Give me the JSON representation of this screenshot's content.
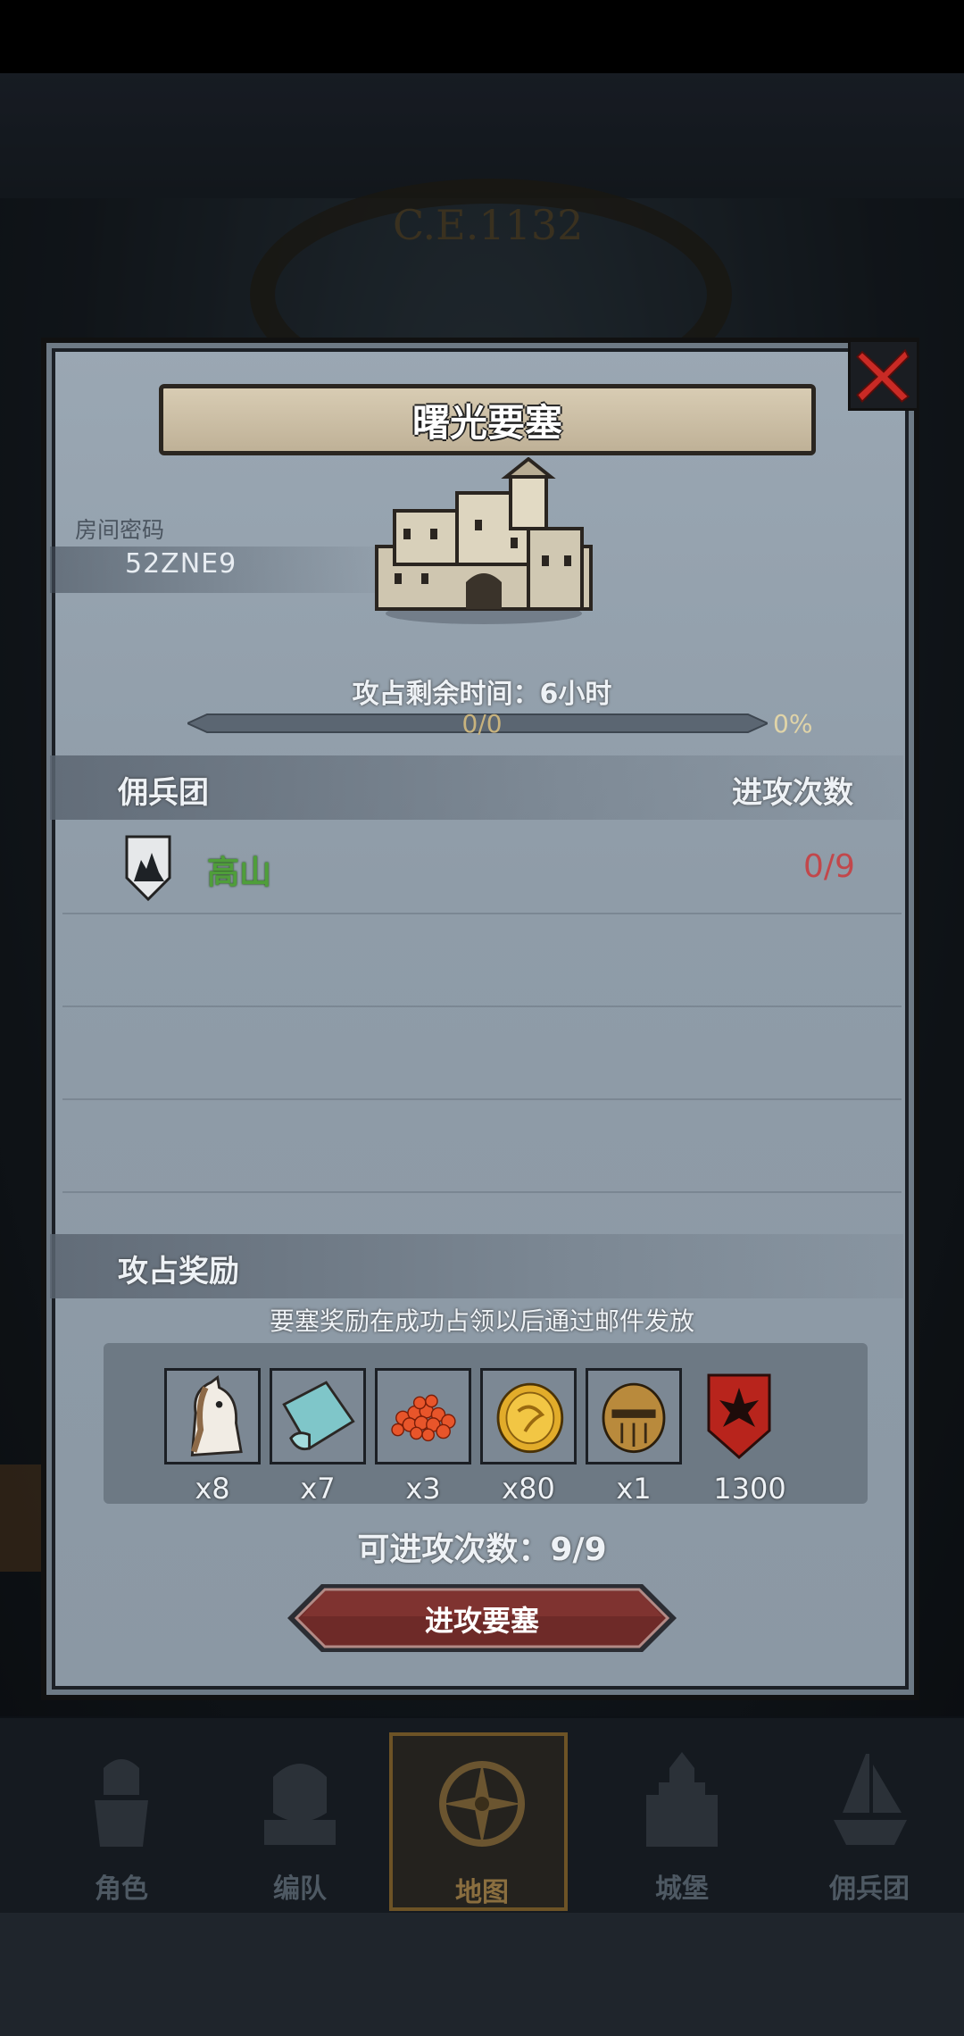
{
  "background": {
    "year_text": "C.E.1132"
  },
  "dialog": {
    "title": "曙光要塞",
    "room_password_label": "房间密码",
    "room_password": "52ZNE9",
    "timer_text": "攻占剩余时间：6小时",
    "progress": {
      "text": "0/0",
      "percent_text": "0%",
      "fraction": 0
    },
    "table": {
      "col_guild": "佣兵团",
      "col_attacks": "进攻次数",
      "rows": [
        {
          "name": "高山",
          "attacks": "0/9"
        }
      ]
    },
    "rewards": {
      "header": "攻占奖励",
      "note": "要塞奖励在成功占领以后通过邮件发放",
      "items": [
        {
          "icon": "horse-icon",
          "qty": "x8"
        },
        {
          "icon": "cloth-icon",
          "qty": "x7"
        },
        {
          "icon": "roe-icon",
          "qty": "x3"
        },
        {
          "icon": "gold-coin-icon",
          "qty": "x80"
        },
        {
          "icon": "knight-helmet-icon",
          "qty": "x1"
        },
        {
          "icon": "guild-banner-icon",
          "qty": "1300"
        }
      ]
    },
    "attacks_available": "可进攻次数：9/9",
    "attack_button": "进攻要塞"
  },
  "nav": {
    "items": [
      {
        "label": "角色",
        "icon": "knight-icon"
      },
      {
        "label": "编队",
        "icon": "formation-icon"
      },
      {
        "label": "地图",
        "icon": "compass-icon",
        "active": true
      },
      {
        "label": "城堡",
        "icon": "castle-icon"
      },
      {
        "label": "佣兵团",
        "icon": "ship-icon"
      }
    ]
  },
  "colors": {
    "panel": "#8f9ca8",
    "guild_name": "#4f9e3a",
    "attack_count": "#c2474b",
    "button": "#6e2a28",
    "nav_active": "#8a6e3f"
  }
}
